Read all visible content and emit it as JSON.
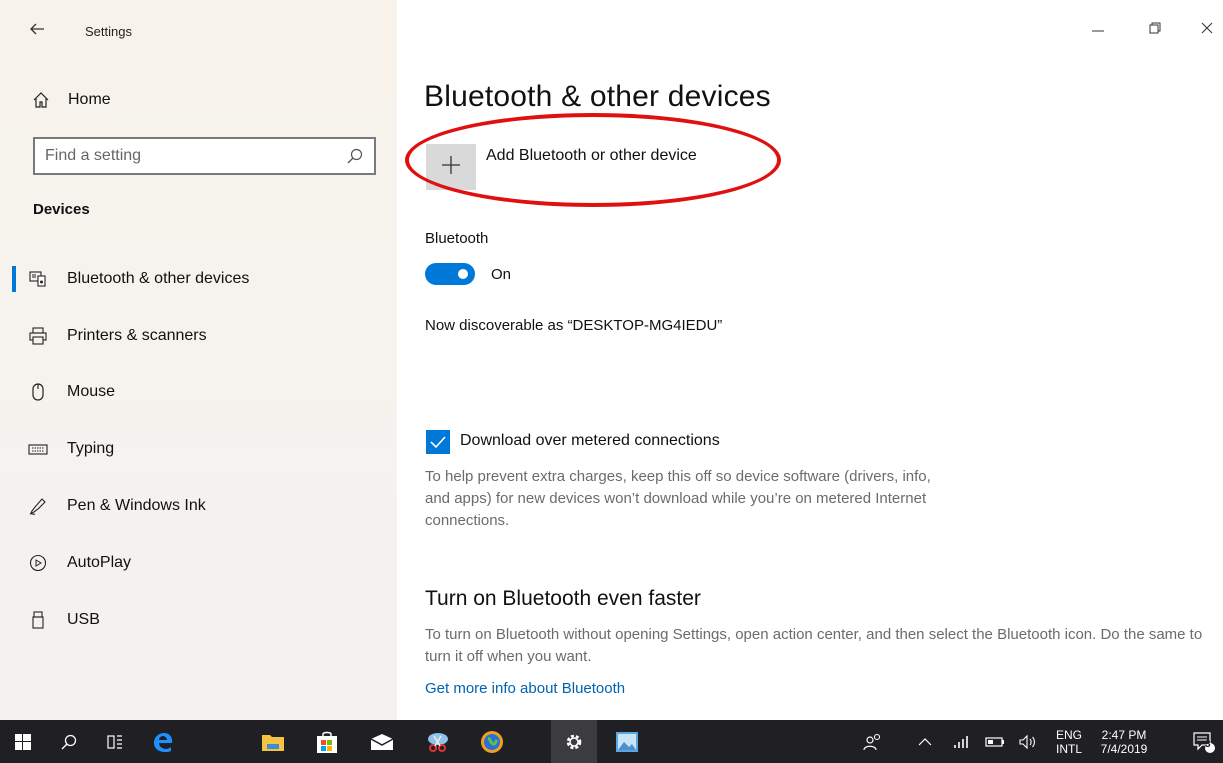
{
  "window": {
    "title": "Settings"
  },
  "sidebar": {
    "home_label": "Home",
    "search_placeholder": "Find a setting",
    "section_title": "Devices",
    "items": [
      {
        "label": "Bluetooth & other devices",
        "icon": "bluetooth-devices-icon",
        "active": true
      },
      {
        "label": "Printers & scanners",
        "icon": "printer-icon",
        "active": false
      },
      {
        "label": "Mouse",
        "icon": "mouse-icon",
        "active": false
      },
      {
        "label": "Typing",
        "icon": "keyboard-icon",
        "active": false
      },
      {
        "label": "Pen & Windows Ink",
        "icon": "pen-icon",
        "active": false
      },
      {
        "label": "AutoPlay",
        "icon": "autoplay-icon",
        "active": false
      },
      {
        "label": "USB",
        "icon": "usb-icon",
        "active": false
      }
    ]
  },
  "main": {
    "title": "Bluetooth & other devices",
    "add_device_label": "Add Bluetooth or other device",
    "bluetooth_label": "Bluetooth",
    "bluetooth_state": "On",
    "discoverable_text": "Now discoverable as “DESKTOP-MG4IEDU”",
    "metered_label": "Download over metered connections",
    "metered_checked": true,
    "metered_description": "To help prevent extra charges, keep this off so device software (drivers, info, and apps) for new devices won’t download while you’re on metered Internet connections.",
    "faster_title": "Turn on Bluetooth even faster",
    "faster_description": "To turn on Bluetooth without opening Settings, open action center, and then select the Bluetooth icon. Do the same to turn it off when you want.",
    "more_info_link": "Get more info about Bluetooth"
  },
  "taskbar": {
    "language_top": "ENG",
    "language_bottom": "INTL",
    "time": "2:47 PM",
    "date": "7/4/2019",
    "notification_count": "3"
  },
  "colors": {
    "accent": "#0078d7",
    "highlight_annotation": "#e01010",
    "taskbar_bg": "#1f1f24"
  }
}
